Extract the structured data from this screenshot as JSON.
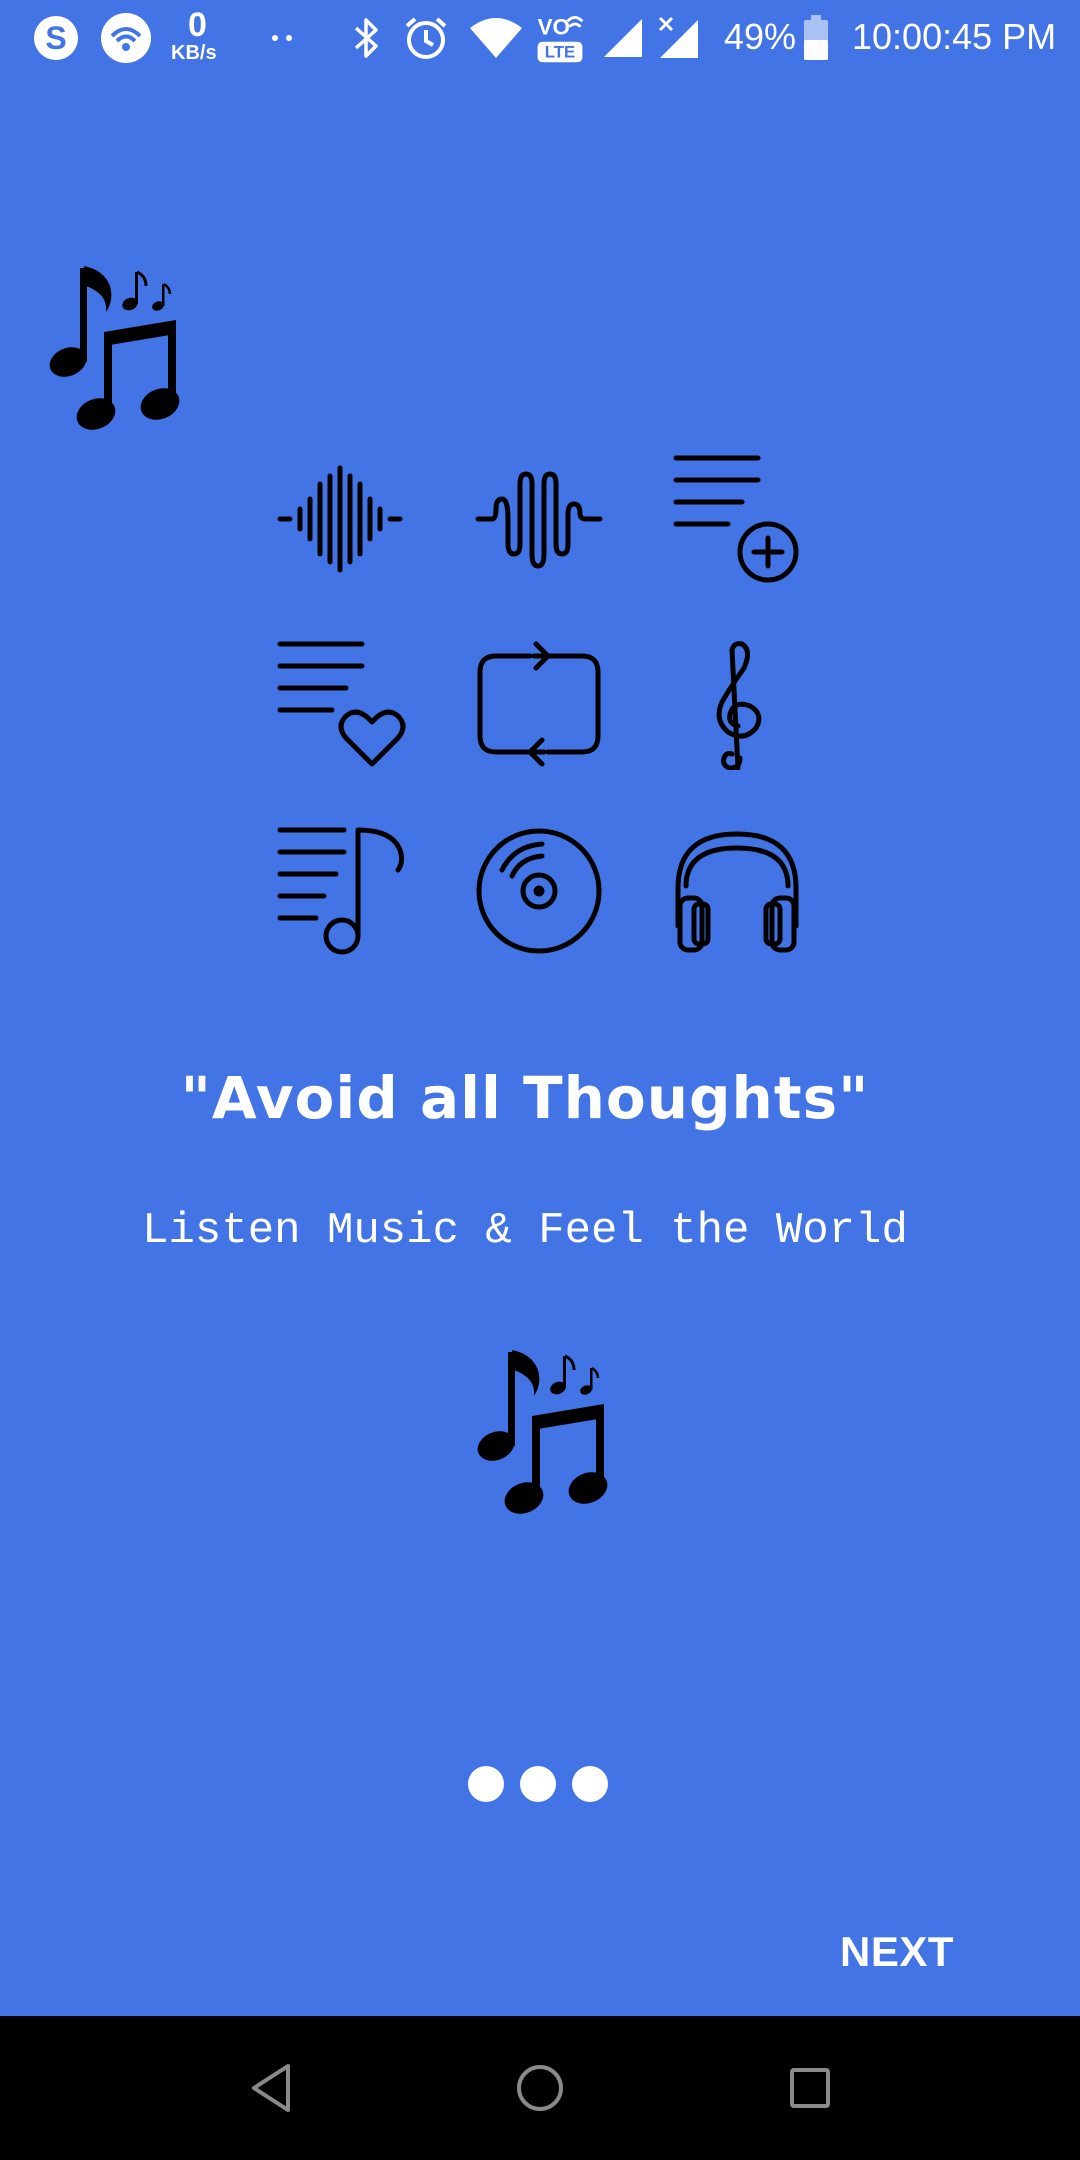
{
  "status_bar": {
    "data_speed_value": "0",
    "data_speed_unit": "KB/s",
    "network_type": "LTE",
    "volte_label": "VO",
    "battery_percent": "49%",
    "time": "10:00:45 PM",
    "icons": [
      "skype-icon",
      "wifi-hotspot-icon",
      "more-dots-icon",
      "bluetooth-icon",
      "alarm-icon",
      "wifi-icon",
      "volte-icon",
      "signal-icon",
      "signal-no-data-icon",
      "battery-icon"
    ]
  },
  "onboarding": {
    "headline": "\"Avoid all Thoughts\"",
    "subline": "Listen Music & Feel the World",
    "feature_icons": [
      "sound-wave-icon",
      "audio-wave-icon",
      "playlist-add-icon",
      "playlist-favorite-icon",
      "repeat-icon",
      "treble-clef-icon",
      "playlist-music-icon",
      "vinyl-disc-icon",
      "headphones-icon"
    ],
    "page_indicator": {
      "count": 3,
      "active": 0
    },
    "next_label": "NEXT"
  },
  "nav_bar": {
    "buttons": [
      "back-icon",
      "home-icon",
      "recents-icon"
    ]
  },
  "colors": {
    "background": "#4374E5",
    "text": "#FFFFFF",
    "icon": "#000000",
    "nav_bar": "#000000"
  }
}
